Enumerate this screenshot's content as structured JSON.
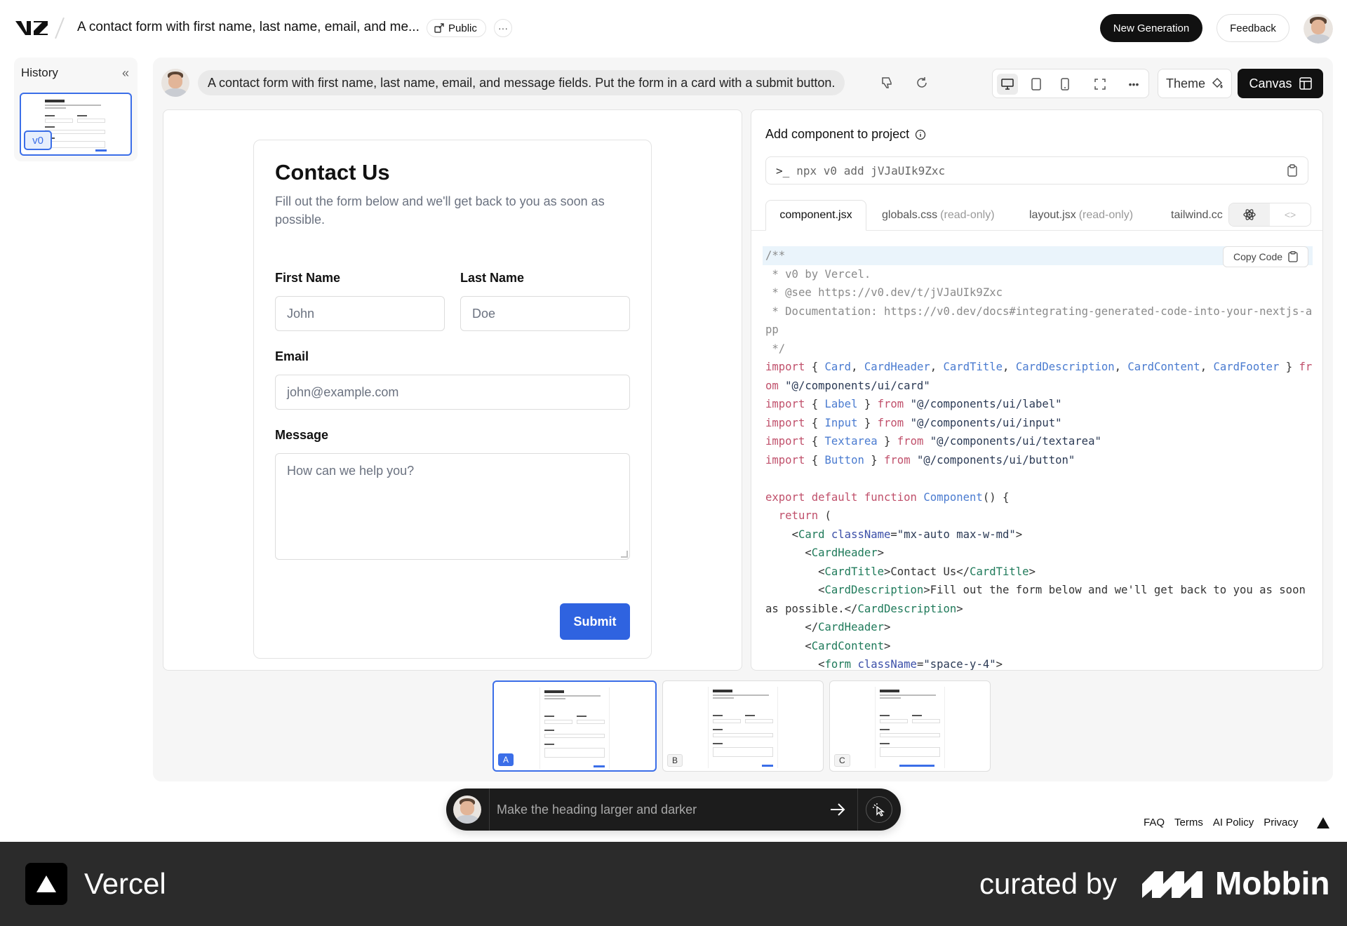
{
  "header": {
    "title": "A contact form with first name, last name, email, and me...",
    "public_label": "Public",
    "more_label": "···",
    "new_generation_label": "New Generation",
    "feedback_label": "Feedback"
  },
  "history": {
    "title": "History",
    "version_label": "v0"
  },
  "prompt": {
    "text": "A contact form with first name, last name, email, and message fields. Put the form in a card with a submit button."
  },
  "toolbar": {
    "theme_label": "Theme",
    "canvas_label": "Canvas"
  },
  "preview": {
    "title": "Contact Us",
    "description": "Fill out the form below and we'll get back to you as soon as possible.",
    "first_name_label": "First Name",
    "first_name_placeholder": "John",
    "last_name_label": "Last Name",
    "last_name_placeholder": "Doe",
    "email_label": "Email",
    "email_placeholder": "john@example.com",
    "message_label": "Message",
    "message_placeholder": "How can we help you?",
    "submit_label": "Submit"
  },
  "code_panel": {
    "add_title": "Add component to project",
    "command": "npx v0 add jVJaUIk9Zxc",
    "tabs": [
      {
        "name": "component.jsx",
        "suffix": ""
      },
      {
        "name": "globals.css",
        "suffix": "(read-only)"
      },
      {
        "name": "layout.jsx",
        "suffix": "(read-only)"
      },
      {
        "name": "tailwind.cc",
        "suffix": ""
      }
    ],
    "copy_label": "Copy Code"
  },
  "variants": [
    {
      "label": "A",
      "title": "Contact Us"
    },
    {
      "label": "B",
      "title": "Contact Us"
    },
    {
      "label": "C",
      "title": "Get In Touch"
    }
  ],
  "chat": {
    "placeholder": "Make the heading larger and darker"
  },
  "footer": {
    "links": [
      "FAQ",
      "Terms",
      "AI Policy",
      "Privacy"
    ]
  },
  "banner": {
    "brand": "Vercel",
    "curated": "curated by",
    "curator": "Mobbin"
  }
}
